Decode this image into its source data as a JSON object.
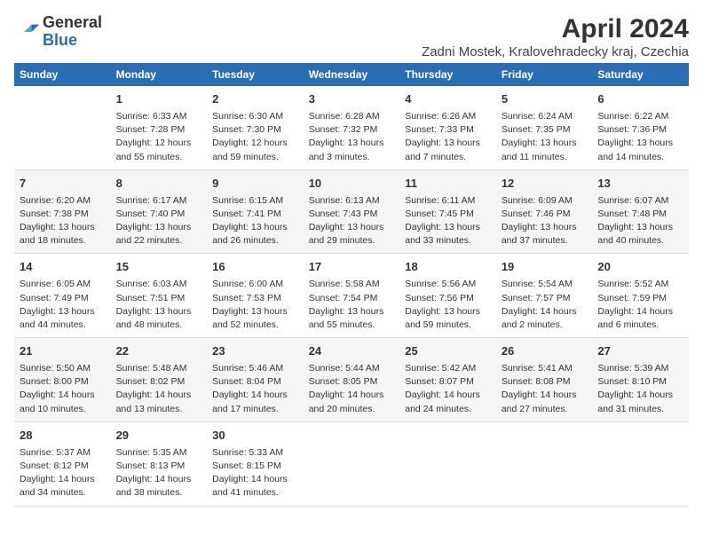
{
  "logo": {
    "general": "General",
    "blue": "Blue"
  },
  "title": "April 2024",
  "subtitle": "Zadni Mostek, Kralovehradecky kraj, Czechia",
  "headers": [
    "Sunday",
    "Monday",
    "Tuesday",
    "Wednesday",
    "Thursday",
    "Friday",
    "Saturday"
  ],
  "weeks": [
    [
      {
        "day": "",
        "content": ""
      },
      {
        "day": "1",
        "content": "Sunrise: 6:33 AM\nSunset: 7:28 PM\nDaylight: 12 hours\nand 55 minutes."
      },
      {
        "day": "2",
        "content": "Sunrise: 6:30 AM\nSunset: 7:30 PM\nDaylight: 12 hours\nand 59 minutes."
      },
      {
        "day": "3",
        "content": "Sunrise: 6:28 AM\nSunset: 7:32 PM\nDaylight: 13 hours\nand 3 minutes."
      },
      {
        "day": "4",
        "content": "Sunrise: 6:26 AM\nSunset: 7:33 PM\nDaylight: 13 hours\nand 7 minutes."
      },
      {
        "day": "5",
        "content": "Sunrise: 6:24 AM\nSunset: 7:35 PM\nDaylight: 13 hours\nand 11 minutes."
      },
      {
        "day": "6",
        "content": "Sunrise: 6:22 AM\nSunset: 7:36 PM\nDaylight: 13 hours\nand 14 minutes."
      }
    ],
    [
      {
        "day": "7",
        "content": "Sunrise: 6:20 AM\nSunset: 7:38 PM\nDaylight: 13 hours\nand 18 minutes."
      },
      {
        "day": "8",
        "content": "Sunrise: 6:17 AM\nSunset: 7:40 PM\nDaylight: 13 hours\nand 22 minutes."
      },
      {
        "day": "9",
        "content": "Sunrise: 6:15 AM\nSunset: 7:41 PM\nDaylight: 13 hours\nand 26 minutes."
      },
      {
        "day": "10",
        "content": "Sunrise: 6:13 AM\nSunset: 7:43 PM\nDaylight: 13 hours\nand 29 minutes."
      },
      {
        "day": "11",
        "content": "Sunrise: 6:11 AM\nSunset: 7:45 PM\nDaylight: 13 hours\nand 33 minutes."
      },
      {
        "day": "12",
        "content": "Sunrise: 6:09 AM\nSunset: 7:46 PM\nDaylight: 13 hours\nand 37 minutes."
      },
      {
        "day": "13",
        "content": "Sunrise: 6:07 AM\nSunset: 7:48 PM\nDaylight: 13 hours\nand 40 minutes."
      }
    ],
    [
      {
        "day": "14",
        "content": "Sunrise: 6:05 AM\nSunset: 7:49 PM\nDaylight: 13 hours\nand 44 minutes."
      },
      {
        "day": "15",
        "content": "Sunrise: 6:03 AM\nSunset: 7:51 PM\nDaylight: 13 hours\nand 48 minutes."
      },
      {
        "day": "16",
        "content": "Sunrise: 6:00 AM\nSunset: 7:53 PM\nDaylight: 13 hours\nand 52 minutes."
      },
      {
        "day": "17",
        "content": "Sunrise: 5:58 AM\nSunset: 7:54 PM\nDaylight: 13 hours\nand 55 minutes."
      },
      {
        "day": "18",
        "content": "Sunrise: 5:56 AM\nSunset: 7:56 PM\nDaylight: 13 hours\nand 59 minutes."
      },
      {
        "day": "19",
        "content": "Sunrise: 5:54 AM\nSunset: 7:57 PM\nDaylight: 14 hours\nand 2 minutes."
      },
      {
        "day": "20",
        "content": "Sunrise: 5:52 AM\nSunset: 7:59 PM\nDaylight: 14 hours\nand 6 minutes."
      }
    ],
    [
      {
        "day": "21",
        "content": "Sunrise: 5:50 AM\nSunset: 8:00 PM\nDaylight: 14 hours\nand 10 minutes."
      },
      {
        "day": "22",
        "content": "Sunrise: 5:48 AM\nSunset: 8:02 PM\nDaylight: 14 hours\nand 13 minutes."
      },
      {
        "day": "23",
        "content": "Sunrise: 5:46 AM\nSunset: 8:04 PM\nDaylight: 14 hours\nand 17 minutes."
      },
      {
        "day": "24",
        "content": "Sunrise: 5:44 AM\nSunset: 8:05 PM\nDaylight: 14 hours\nand 20 minutes."
      },
      {
        "day": "25",
        "content": "Sunrise: 5:42 AM\nSunset: 8:07 PM\nDaylight: 14 hours\nand 24 minutes."
      },
      {
        "day": "26",
        "content": "Sunrise: 5:41 AM\nSunset: 8:08 PM\nDaylight: 14 hours\nand 27 minutes."
      },
      {
        "day": "27",
        "content": "Sunrise: 5:39 AM\nSunset: 8:10 PM\nDaylight: 14 hours\nand 31 minutes."
      }
    ],
    [
      {
        "day": "28",
        "content": "Sunrise: 5:37 AM\nSunset: 8:12 PM\nDaylight: 14 hours\nand 34 minutes."
      },
      {
        "day": "29",
        "content": "Sunrise: 5:35 AM\nSunset: 8:13 PM\nDaylight: 14 hours\nand 38 minutes."
      },
      {
        "day": "30",
        "content": "Sunrise: 5:33 AM\nSunset: 8:15 PM\nDaylight: 14 hours\nand 41 minutes."
      },
      {
        "day": "",
        "content": ""
      },
      {
        "day": "",
        "content": ""
      },
      {
        "day": "",
        "content": ""
      },
      {
        "day": "",
        "content": ""
      }
    ]
  ]
}
